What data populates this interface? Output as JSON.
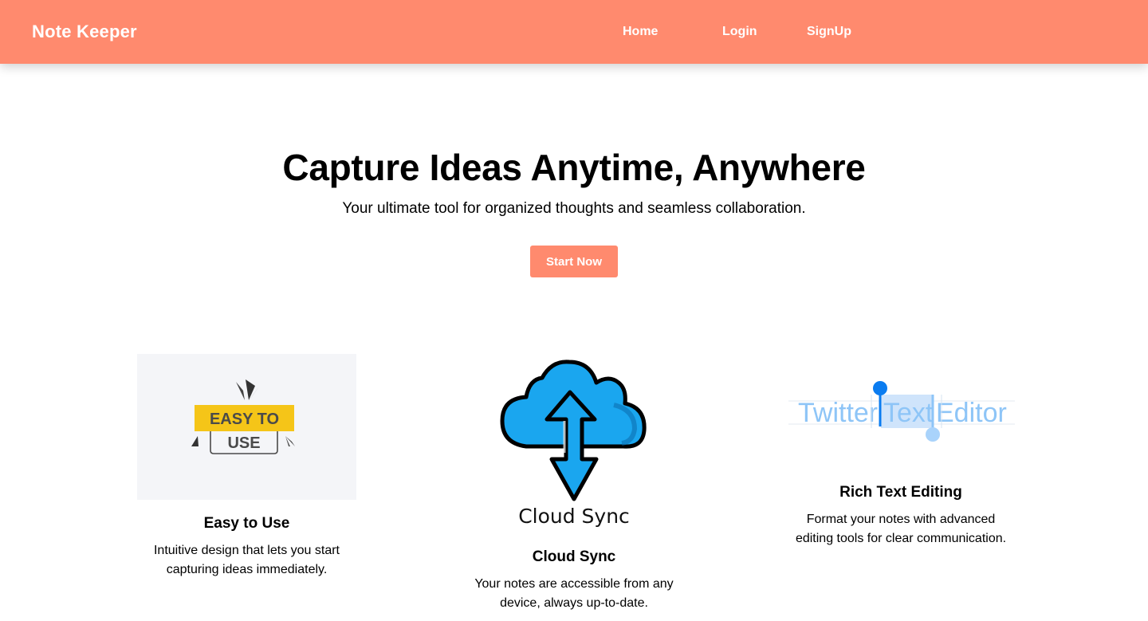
{
  "nav": {
    "brand": "Note Keeper",
    "links": [
      "Home",
      "Login",
      "SignUp"
    ]
  },
  "hero": {
    "title": "Capture Ideas Anytime, Anywhere",
    "subtitle": "Your ultimate tool for organized thoughts and seamless collaboration.",
    "cta_label": "Start Now"
  },
  "features": [
    {
      "image_text_line1": "EASY TO",
      "image_text_line2": "USE",
      "title": "Easy to Use",
      "desc_line1": "Intuitive design that lets you start",
      "desc_line2": "capturing ideas immediately."
    },
    {
      "image_text": "Cloud Sync",
      "title": "Cloud Sync",
      "desc_line1": "Your notes are accessible from any",
      "desc_line2": "device, always up-to-date."
    },
    {
      "image_text_1": "Twitter",
      "image_text_2": "Text",
      "image_text_3": "Editor",
      "title": "Rich Text Editing",
      "desc_line1": "Format your notes with advanced",
      "desc_line2": "editing tools for clear communication."
    }
  ],
  "colors": {
    "accent": "#ff8a6e",
    "cloud_blue": "#1aa6ef",
    "badge_yellow": "#f5c518",
    "editor_blue": "#8ec5f7"
  }
}
